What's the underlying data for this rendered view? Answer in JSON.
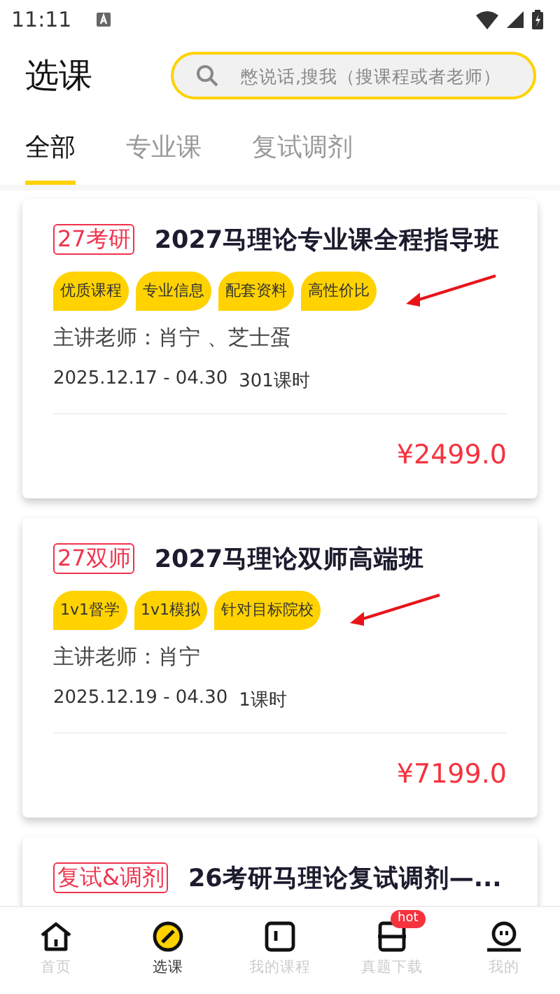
{
  "status_bar": {
    "time": "11:11"
  },
  "header": {
    "title": "选课",
    "search": {
      "placeholder": "憋说话,搜我（搜课程或者老师）"
    }
  },
  "tabs": [
    {
      "label": "全部",
      "selected": true
    },
    {
      "label": "专业课",
      "selected": false
    },
    {
      "label": "复试调剂",
      "selected": false
    }
  ],
  "courses": [
    {
      "badge": "27考研",
      "title": "2027马理论专业课全程指导班",
      "tags": [
        "优质课程",
        "专业信息",
        "配套资料",
        "高性价比"
      ],
      "teachers": "主讲老师：肖宁 、芝士蛋",
      "dates": "2025.12.17 - 04.30",
      "hours": "301课时",
      "price": "¥2499.0"
    },
    {
      "badge": "27双师",
      "title": "2027马理论双师高端班",
      "tags": [
        "1v1督学",
        "1v1模拟",
        "针对目标院校"
      ],
      "teachers": "主讲老师：肖宁",
      "dates": "2025.12.19 - 04.30",
      "hours": "1课时",
      "price": "¥7199.0"
    },
    {
      "badge": "复试&调剂",
      "title": "26考研马理论复试调剂—..."
    }
  ],
  "nav": [
    {
      "label": "首页",
      "selected": false
    },
    {
      "label": "选课",
      "selected": true
    },
    {
      "label": "我的课程",
      "selected": false
    },
    {
      "label": "真题下载",
      "selected": false,
      "badge": "hot"
    },
    {
      "label": "我的",
      "selected": false
    }
  ]
}
